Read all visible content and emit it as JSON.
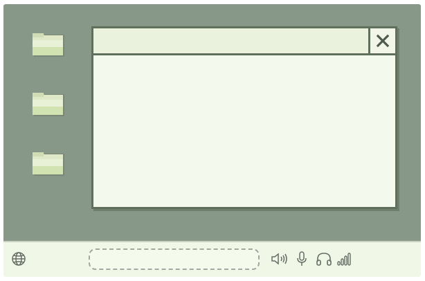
{
  "desktop": {
    "icons": [
      {
        "name": "folder-icon-1"
      },
      {
        "name": "folder-icon-2"
      },
      {
        "name": "folder-icon-3"
      }
    ]
  },
  "window": {
    "title": "",
    "close_glyph": "✕",
    "body_text": ""
  },
  "taskbar": {
    "search": {
      "value": "",
      "placeholder": ""
    },
    "icons": [
      "globe-icon",
      "speaker-icon",
      "microphone-icon",
      "headphones-icon",
      "signal-icon"
    ]
  },
  "colors": {
    "desktop": "#889888",
    "window": "#f3f8ec",
    "border": "#5f6f5c",
    "taskbar": "#f0f7e6"
  }
}
